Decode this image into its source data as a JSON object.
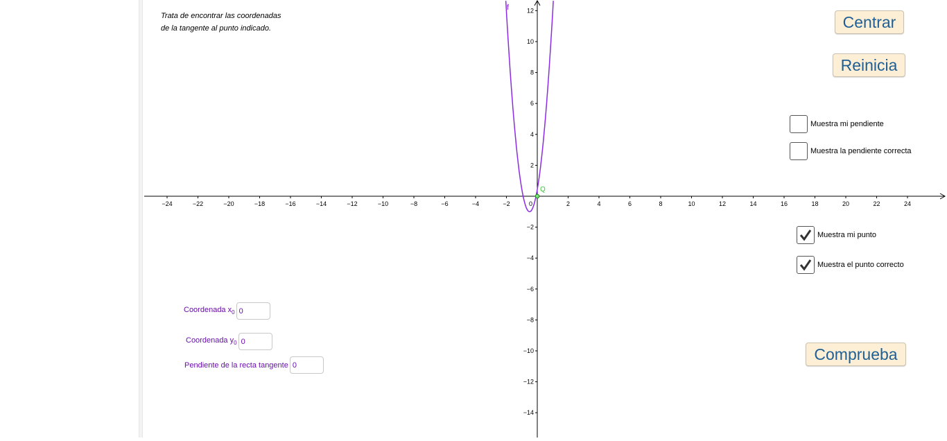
{
  "instructions": {
    "line1": "Trata de encontrar las coordenadas",
    "line2": "de la tangente al punto indicado."
  },
  "buttons": {
    "centrar": "Centrar",
    "reinicia": "Reinicia",
    "comprueba": "Comprueba"
  },
  "checkboxes": [
    {
      "label": "Muestra mi pendiente",
      "checked": false
    },
    {
      "label": "Muestra la pendiente correcta",
      "checked": false
    },
    {
      "label": "Muestra mi punto",
      "checked": true
    },
    {
      "label": "Muestra el punto correcto",
      "checked": true
    }
  ],
  "inputs": {
    "x0": {
      "label": "Coordenada x",
      "sub": "0",
      "value": "0"
    },
    "y0": {
      "label": "Coordenada y",
      "sub": "0",
      "value": "0"
    },
    "slope": {
      "label": "Pendiente de la recta tangente",
      "value": "0"
    }
  },
  "graph": {
    "function_label": "f",
    "point_label": "Q",
    "x_ticks": [
      "−24",
      "−22",
      "−20",
      "−18",
      "−16",
      "−14",
      "−12",
      "−10",
      "−8",
      "−6",
      "−4",
      "−2",
      "2",
      "4",
      "6",
      "8",
      "10",
      "12",
      "14",
      "16",
      "18",
      "20",
      "22",
      "24"
    ],
    "y_ticks_pos": [
      "12",
      "10",
      "8",
      "6",
      "4",
      "2"
    ],
    "y_ticks_neg": [
      "−2",
      "−4",
      "−6",
      "−8",
      "−10",
      "−12",
      "−14"
    ],
    "origin_label": "0",
    "curve_color": "#8a2be2",
    "point_color": "#00cc00"
  }
}
